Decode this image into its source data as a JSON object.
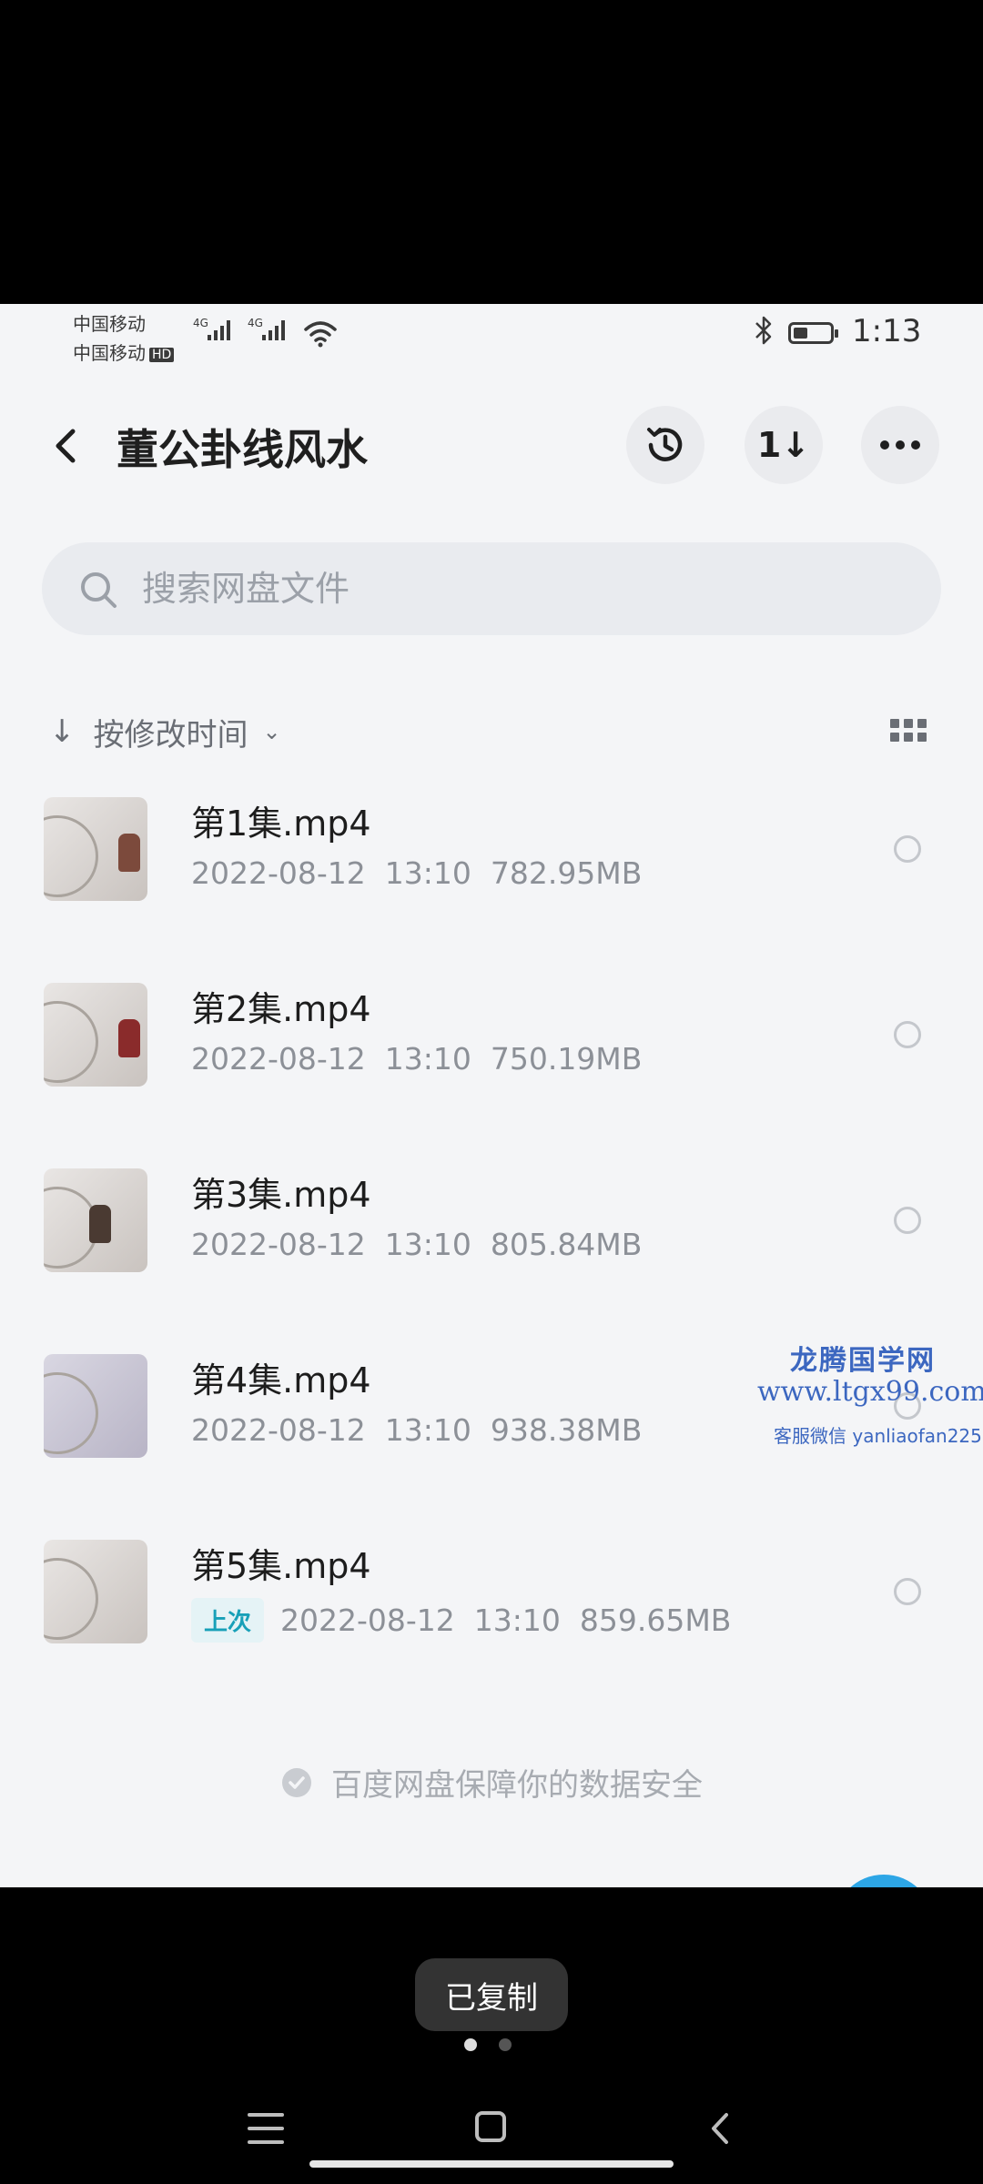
{
  "status_bar": {
    "carrier1": "中国移动",
    "carrier2": "中国移动",
    "hd_badge": "HD",
    "network1": "4G",
    "network2": "4G",
    "time": "1:13",
    "icons": [
      "signal-icon",
      "wifi-icon",
      "bluetooth-icon",
      "battery-icon"
    ]
  },
  "header": {
    "title": "董公卦线风水",
    "sort_button_label": "1↓",
    "icons": [
      "back-icon",
      "history-icon",
      "sort-icon",
      "more-icon"
    ]
  },
  "search": {
    "placeholder": "搜索网盘文件"
  },
  "sort": {
    "label": "按修改时间",
    "arrow": "↓",
    "chevron": "⌄"
  },
  "files": [
    {
      "name": "第1集.mp4",
      "meta": "2022-08-12  13:10  782.95MB",
      "badge": ""
    },
    {
      "name": "第2集.mp4",
      "meta": "2022-08-12  13:10  750.19MB",
      "badge": ""
    },
    {
      "name": "第3集.mp4",
      "meta": "2022-08-12  13:10  805.84MB",
      "badge": ""
    },
    {
      "name": "第4集.mp4",
      "meta": "2022-08-12  13:10  938.38MB",
      "badge": ""
    },
    {
      "name": "第5集.mp4",
      "meta": "2022-08-12  13:10  859.65MB",
      "badge": "上次"
    }
  ],
  "footer": {
    "safety_text": "百度网盘保障你的数据安全"
  },
  "watermark": {
    "line1": "龙腾国学网",
    "line2": "www.ltgx99.com",
    "line3": "客服微信 yanliaofan225"
  },
  "toast": {
    "text": "已复制"
  },
  "colors": {
    "accent": "#18a0b8",
    "background": "#f4f5f7",
    "watermark": "#3c67c0"
  }
}
